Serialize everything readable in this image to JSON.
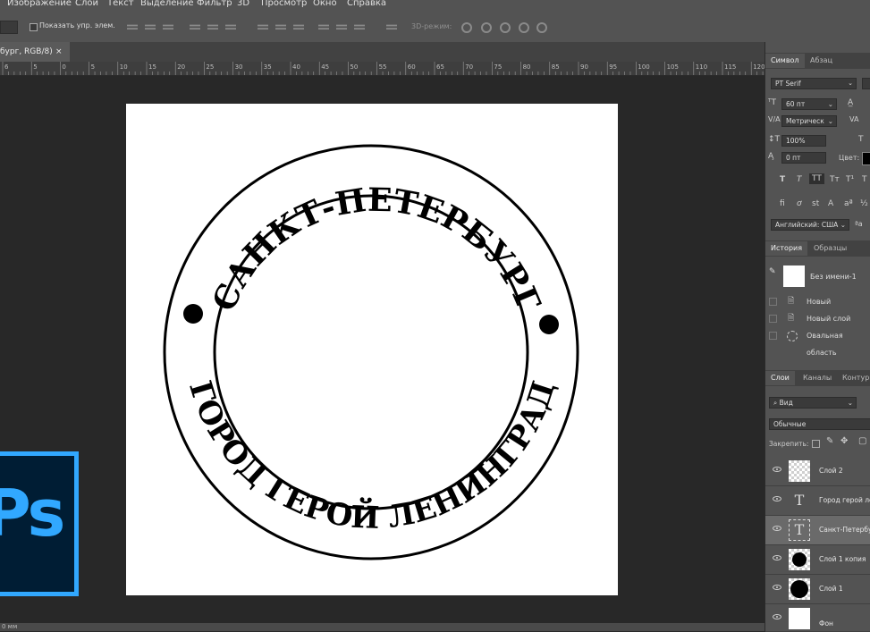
{
  "menu": [
    "Изображение",
    "Слои",
    "Текст",
    "Выделение",
    "Фильтр",
    "3D",
    "Просмотр",
    "Окно",
    "Справка"
  ],
  "options": {
    "show_controls": "Показать упр. элем.",
    "mode3d": "3D-режим:"
  },
  "document_tab": {
    "title": "бург, RGB/8)",
    "close": "×"
  },
  "ruler_labels": [
    "6",
    "5",
    "0",
    "5",
    "10",
    "15",
    "20",
    "25",
    "30",
    "35",
    "40",
    "45",
    "50",
    "55",
    "60",
    "65",
    "70",
    "75",
    "80",
    "85",
    "90",
    "95",
    "100",
    "105",
    "110",
    "115",
    "120"
  ],
  "status": "0 мм",
  "ps_logo": "Ps",
  "stamp": {
    "top_text": "САНКТ-ПЕТЕРБУРГ",
    "bottom_text": "ГОРОД ГЕРОЙ ЛЕНИНГРАД"
  },
  "character_panel": {
    "tabs": [
      "Символ",
      "Абзац"
    ],
    "font": "PT Serif",
    "size": "60 пт",
    "kerning": "Метрическ",
    "scale": "100%",
    "baseline": "0 пт",
    "color_label": "Цвет:",
    "language": "Английский: США",
    "style_buttons": [
      "T",
      "T",
      "TT",
      "Tт",
      "T¹",
      "T"
    ],
    "aa": "ªa"
  },
  "history_panel": {
    "tabs": [
      "История",
      "Образцы"
    ],
    "snapshot": "Без имени-1",
    "items": [
      "Новый",
      "Новый слой",
      "Овальная область"
    ]
  },
  "layers_panel": {
    "tabs": [
      "Слои",
      "Каналы",
      "Контуры"
    ],
    "filter": "Вид",
    "blend": "Обычные",
    "lock_label": "Закрепить:",
    "layers": [
      {
        "name": "Слой 2",
        "kind": "checker"
      },
      {
        "name": "Город герой лен",
        "kind": "text"
      },
      {
        "name": "Санкт-Петербург",
        "kind": "text"
      },
      {
        "name": "Слой 1 копия",
        "kind": "circle"
      },
      {
        "name": "Слой 1",
        "kind": "circle"
      },
      {
        "name": "Фон",
        "kind": "white"
      }
    ]
  }
}
